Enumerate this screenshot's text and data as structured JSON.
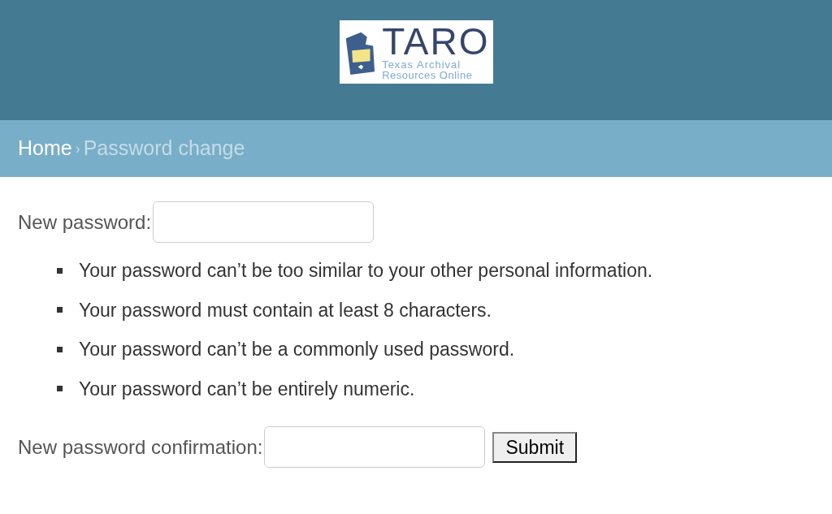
{
  "logo": {
    "title": "TARO",
    "subtitle_1": "Texas Archival",
    "subtitle_2": "Resources Online"
  },
  "breadcrumbs": [
    {
      "label": "Home",
      "kind": "link"
    },
    {
      "label": "›",
      "kind": "separator"
    },
    {
      "label": "Password change",
      "kind": "current"
    }
  ],
  "form": {
    "new_password_label": "New password:",
    "help": [
      "Your password can’t be too similar to your other personal information.",
      "Your password must contain at least 8 characters.",
      "Your password can’t be a commonly used password.",
      "Your password can’t be entirely numeric."
    ],
    "confirmation_label": "New password confirmation:",
    "submit": "Submit"
  }
}
